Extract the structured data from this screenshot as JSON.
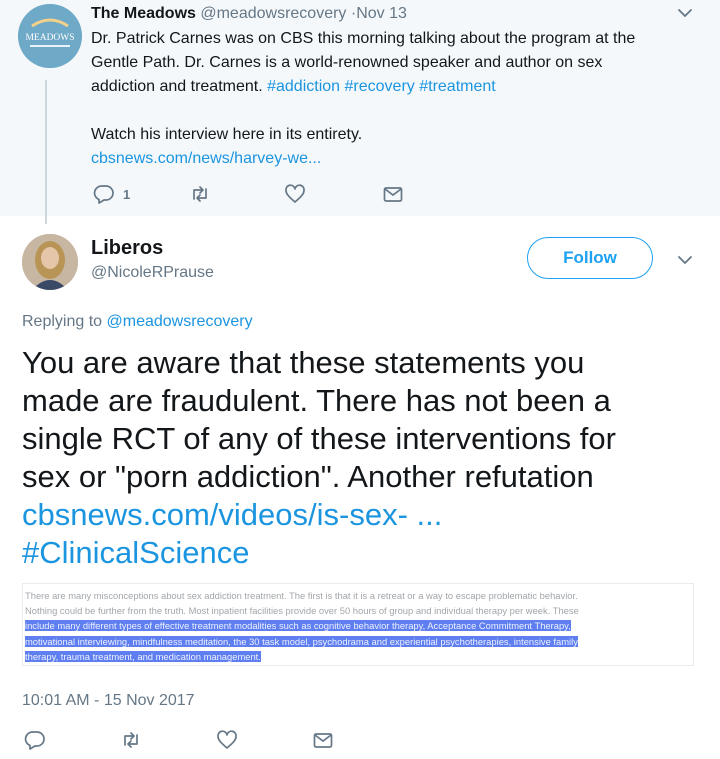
{
  "parent_tweet": {
    "avatar_text": "MEADOWS",
    "name": "The Meadows",
    "handle": "@meadowsrecovery",
    "date": "·Nov 13",
    "text_lines": [
      "Dr. Patrick Carnes was on CBS this morning talking about the program at the",
      "Gentle Path.  Dr. Carnes is a world-renowned speaker and author on sex"
    ],
    "text_line3": "addiction and treatment. ",
    "hashtags": [
      "#addiction",
      "#recovery",
      "#treatment"
    ],
    "watch_text": "Watch his interview here in its entirety.",
    "link": "cbsnews.com/news/harvey-we...",
    "reply_count": "1"
  },
  "main_tweet": {
    "name": "Liberos",
    "handle": "@NicoleRPrause",
    "follow_label": "Follow",
    "replying_prefix": "Replying to ",
    "replying_handle": "@meadowsrecovery",
    "text_lines": [
      "You are aware that these statements you",
      "made are fraudulent. There has not been a",
      "single RCT of any of these interventions for",
      "sex or \"porn addiction\". Another refutation"
    ],
    "link": "cbsnews.com/videos/is-sex- ...",
    "hashtag": "#ClinicalScience",
    "embed_lines": [
      "There are many misconceptions about sex addiction treatment. The first is that it is a retreat or a way to escape problematic behavior.",
      "Nothing could be further from the truth. Most inpatient facilities provide over 50 hours of group and individual therapy per week. These"
    ],
    "embed_highlight_lines": [
      "include many different types of effective treatment modalities such as cognitive behavior therapy, Acceptance Commitment Therapy,",
      "motivational interviewing, mindfulness meditation, the 30 task model, psychodrama and experiential psychotherapies, intensive family",
      "therapy, trauma treatment, and medication management."
    ],
    "timestamp": "10:01 AM - 15 Nov 2017"
  },
  "colors": {
    "link": "#1b95e0",
    "follow": "#1da1f2",
    "muted": "#657786",
    "parent_bg": "#f5f8fa",
    "highlight": "#5f7ff0"
  },
  "icons": [
    "chevron-down-icon",
    "reply-icon",
    "retweet-icon",
    "like-icon",
    "direct-message-icon"
  ]
}
